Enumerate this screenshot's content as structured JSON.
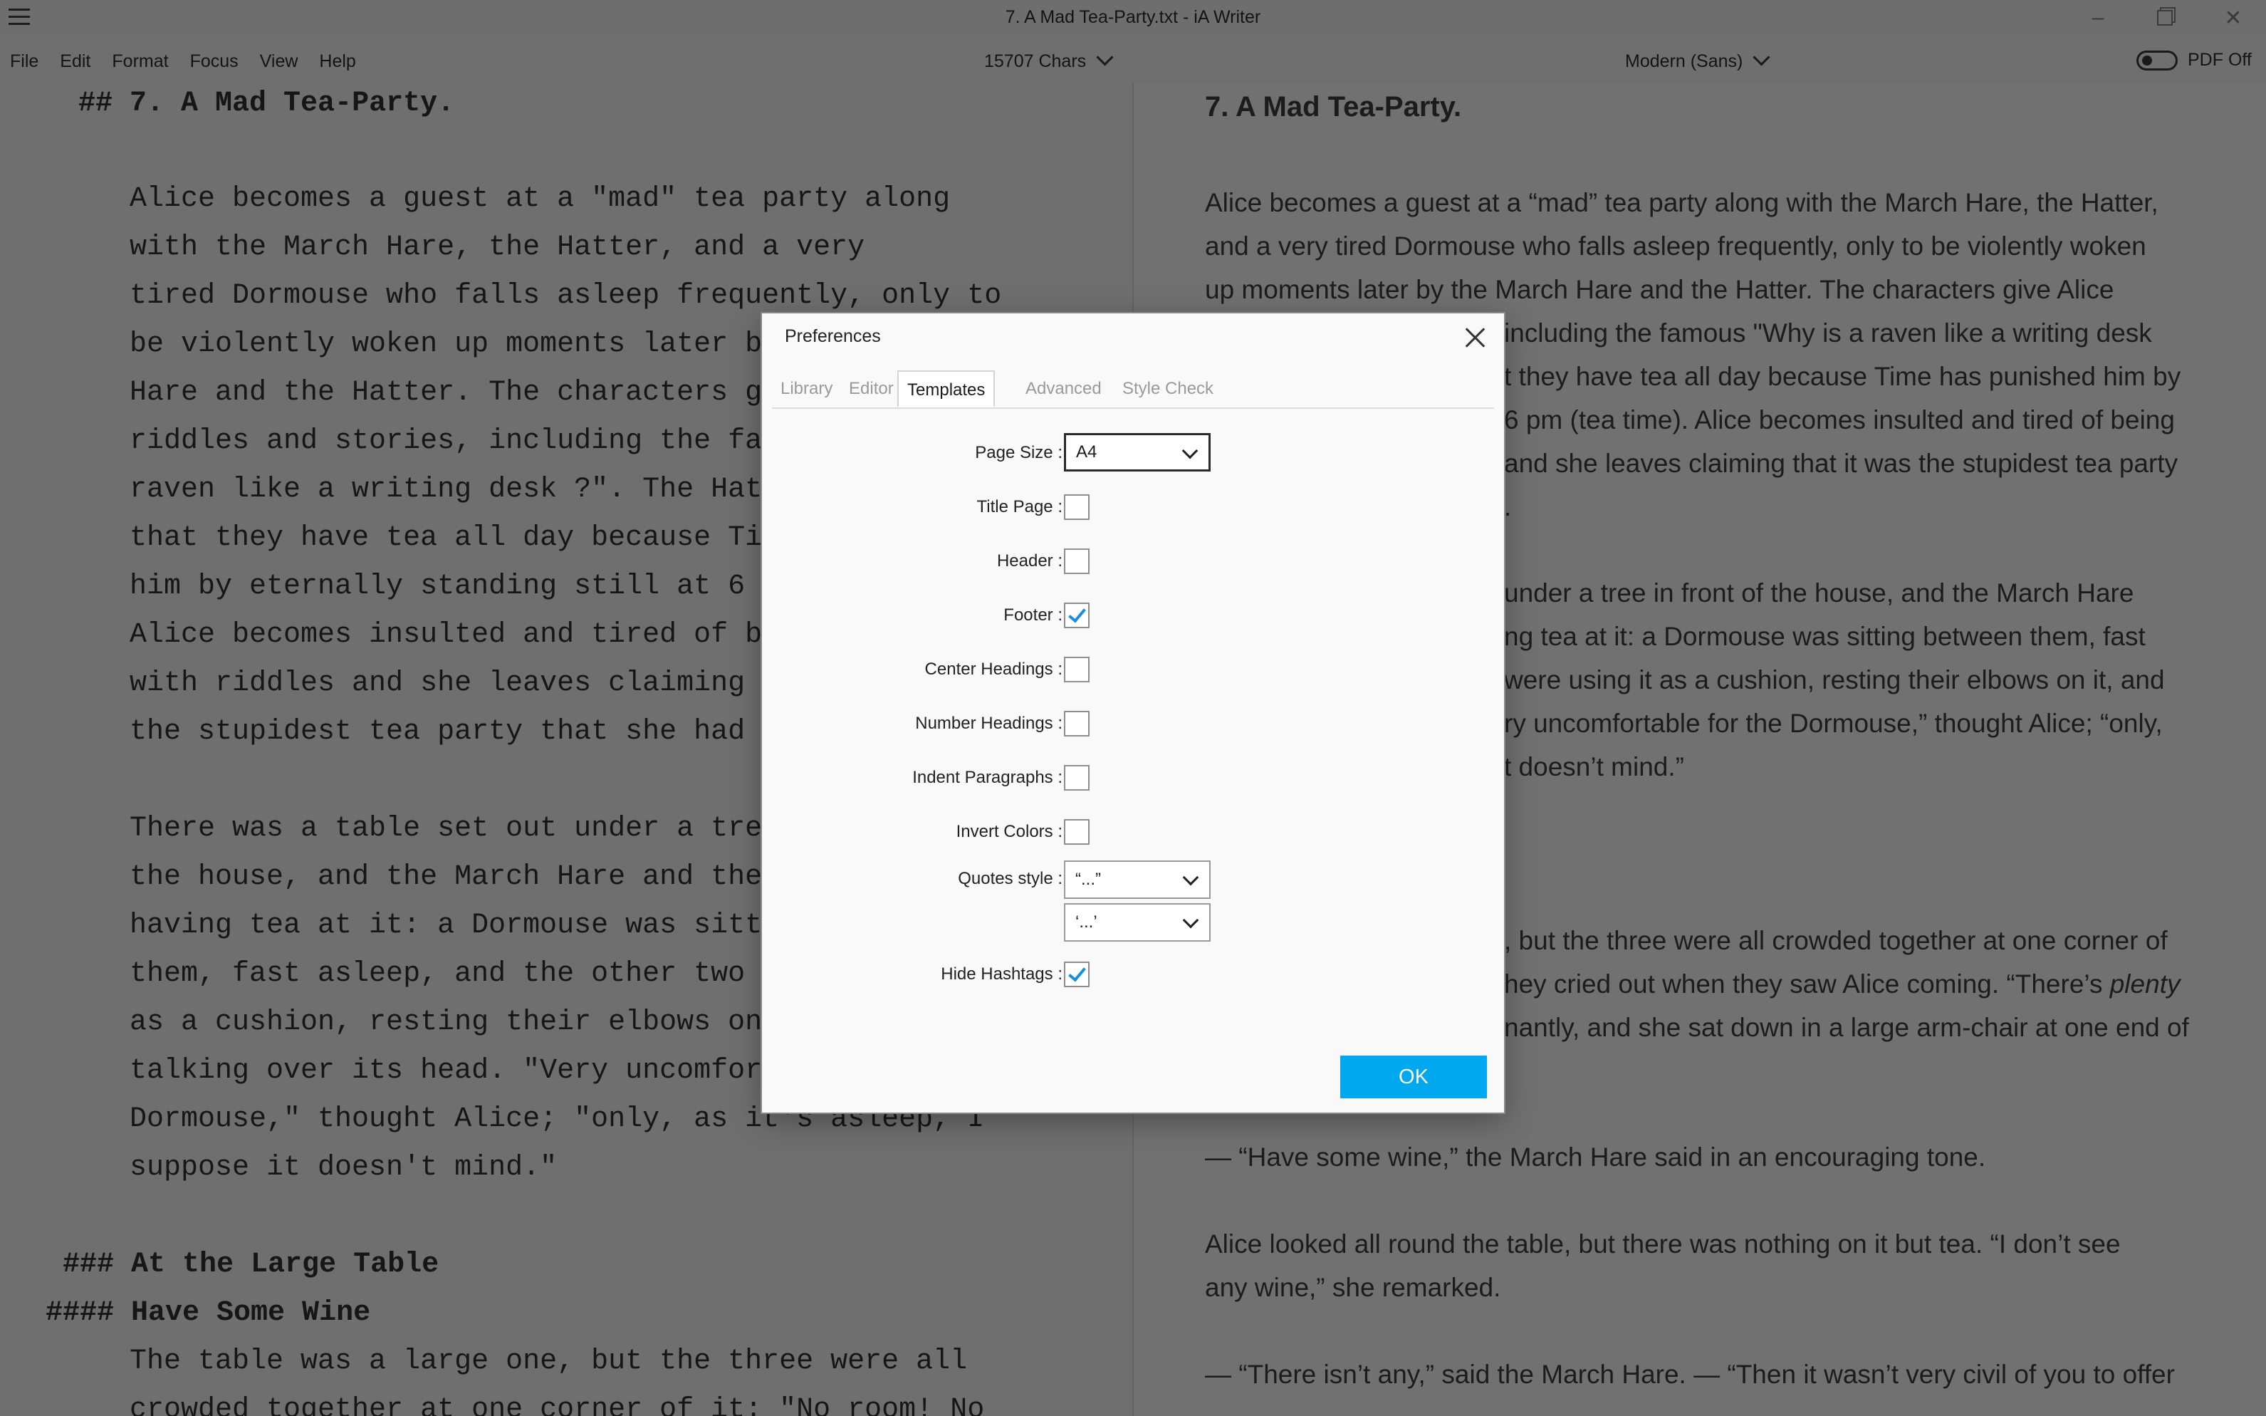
{
  "window": {
    "title": "7. A Mad Tea-Party.txt - iA Writer",
    "controls": [
      "minimize-icon",
      "restore-icon",
      "close-icon"
    ]
  },
  "menubar": {
    "items": [
      "File",
      "Edit",
      "Format",
      "Focus",
      "View",
      "Help"
    ],
    "char_count": "15707 Chars",
    "font_selector": "Modern (Sans)",
    "pdf_toggle_label": "PDF Off"
  },
  "editor": {
    "heading": "## 7. A Mad Tea-Party.",
    "para1": [
      "Alice becomes a guest at a \"mad\" tea party along",
      "with the March Hare, the Hatter, and a very",
      "tired Dormouse who falls asleep frequently, only to",
      "be violently woken up moments later by",
      "Hare and the Hatter. The characters giv",
      "riddles and stories, including the famo",
      "raven like a writing desk ?\". The Hatte",
      "that they have tea all day because Time",
      "him by eternally standing still at 6 pm",
      "Alice becomes insulted and tired of bei",
      "with riddles and she leaves claiming t",
      "the stupidest tea party that she had ev"
    ],
    "para2": [
      "There was a table set out under a tree",
      "the house, and the March Hare and the H",
      "having tea at it: a Dormouse was sitti",
      "them, fast asleep, and the other two w",
      "as a cushion, resting their elbows on i",
      "talking over its head. \"Very uncomforta",
      "Dormouse,\" thought Alice; \"only, as it's asleep, I",
      "suppose it doesn't mind.\""
    ],
    "heading3": "### At the Large Table",
    "heading4": "#### Have Some Wine",
    "para3": [
      "The table was a large one, but the three were all",
      "crowded together at one corner of it: \"No room! No"
    ]
  },
  "preview": {
    "heading": "7. A Mad Tea-Party.",
    "para1": [
      "Alice becomes a guest at a “mad” tea party along with the March Hare, the Hatter,",
      "and a very tired Dormouse who falls asleep frequently, only to be violently woken",
      "up moments later by the March Hare and the Hatter. The characters give Alice",
      "including the famous \"Why is a raven like a writing desk",
      "t they have tea all day because Time has punished him by",
      "6 pm (tea time). Alice becomes insulted and tired of being",
      "and she leaves claiming that it was the stupidest tea party",
      "."
    ],
    "para2": [
      "under a tree in front of the house, and the March Hare",
      "ng tea at it: a Dormouse was sitting between them, fast",
      "were using it as a cushion, resting their elbows on it, and",
      "ry uncomfortable for the Dormouse,” thought Alice; “only,",
      "t doesn’t mind.”"
    ],
    "para3_a": ", but the three were all crowded together at one corner of",
    "para3_b": "hey cried out when they saw Alice coming. “There’s ",
    "para3_b_em": "plenty",
    "para3_c": "nantly, and she sat down in a large arm-chair at one end of",
    "wine_line": "— “Have some wine,” the March Hare said in an encouraging tone.",
    "table_line1": "Alice looked all round the table, but there was nothing on it but tea. “I don’t see",
    "table_line2": "any wine,” she remarked.",
    "last_line": "— “There isn’t any,” said the March Hare. — “Then it wasn’t very civil of you to offer"
  },
  "dialog": {
    "title": "Preferences",
    "tabs": [
      "Library",
      "Editor",
      "Templates",
      "Advanced",
      "Style Check"
    ],
    "active_tab": "Templates",
    "page_size": {
      "label": "Page Size :",
      "value": "A4"
    },
    "title_page": {
      "label": "Title Page :",
      "checked": false
    },
    "header": {
      "label": "Header :",
      "checked": false
    },
    "footer": {
      "label": "Footer :",
      "checked": true
    },
    "center_headings": {
      "label": "Center Headings :",
      "checked": false
    },
    "number_headings": {
      "label": "Number Headings :",
      "checked": false
    },
    "indent_paragraphs": {
      "label": "Indent Paragraphs :",
      "checked": false
    },
    "invert_colors": {
      "label": "Invert Colors :",
      "checked": false
    },
    "quotes_style": {
      "label": "Quotes style :",
      "double": "“...”",
      "single": "‘...’"
    },
    "hide_hashtags": {
      "label": "Hide Hashtags :",
      "checked": true
    },
    "ok_label": "OK"
  },
  "colors": {
    "accent": "#00a8f0",
    "checkmark": "#1a8fe0",
    "dim_background": "#6f6f6f"
  }
}
